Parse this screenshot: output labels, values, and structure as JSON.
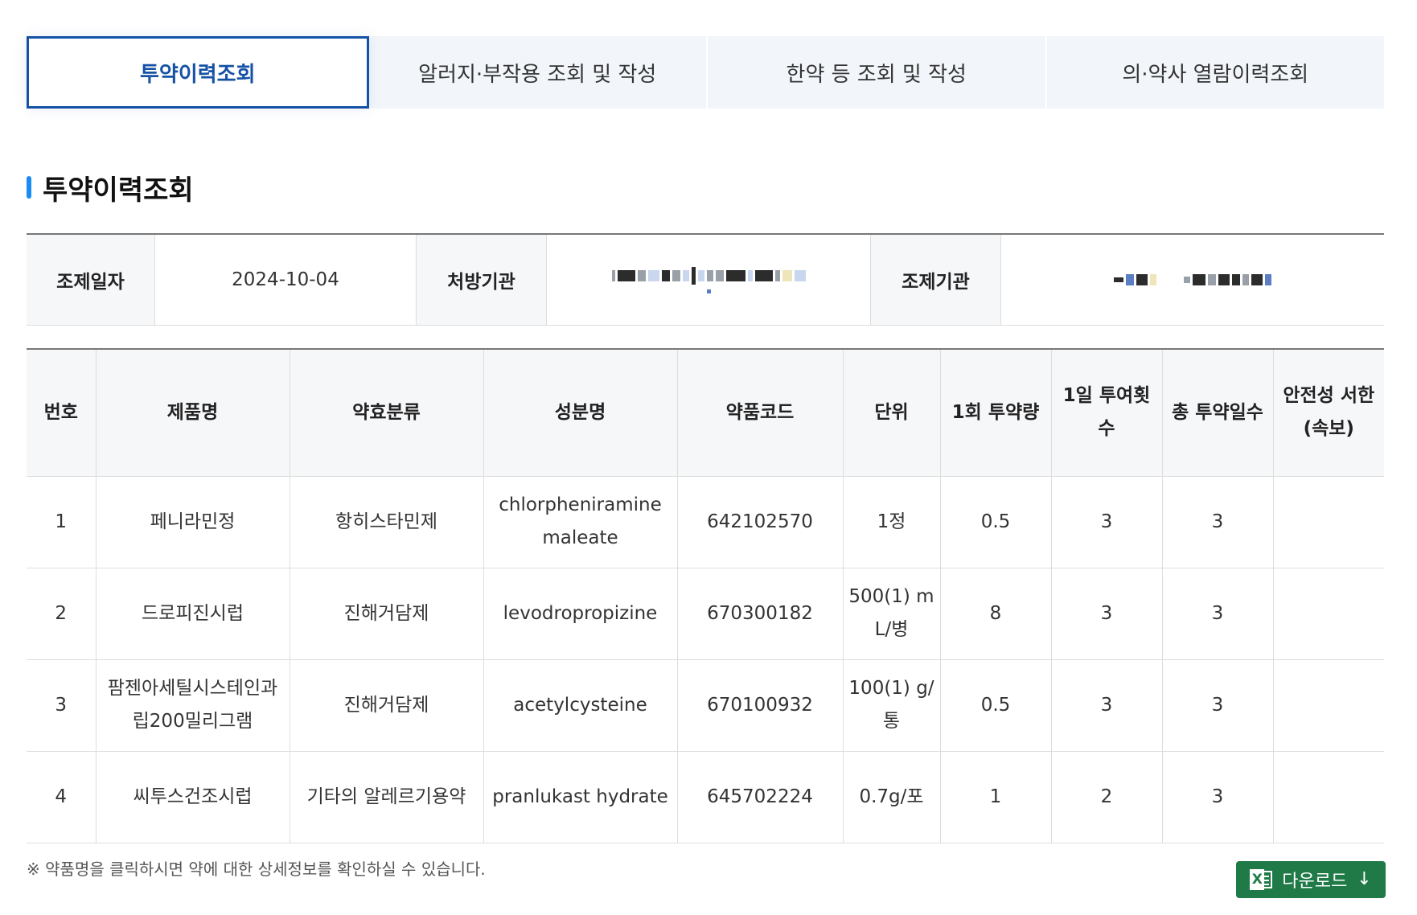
{
  "tabs": [
    {
      "label": "투약이력조회",
      "active": true
    },
    {
      "label": "알러지·부작용 조회 및 작성",
      "active": false
    },
    {
      "label": "한약 등 조회 및 작성",
      "active": false
    },
    {
      "label": "의·약사 열람이력조회",
      "active": false
    }
  ],
  "section_title": "투약이력조회",
  "info": {
    "dispense_date_label": "조제일자",
    "dispense_date": "2024-10-04",
    "prescriber_label": "처방기관",
    "prescriber_value_redacted": true,
    "pharmacy_label": "조제기관",
    "pharmacy_value_redacted": true
  },
  "table": {
    "headers": {
      "no": "번호",
      "product": "제품명",
      "class": "약효분류",
      "ingredient": "성분명",
      "code": "약품코드",
      "unit": "단위",
      "dose": "1회 투약량",
      "daily": "1일 투여횟수",
      "days": "총 투약일수",
      "safety": "안전성 서한(속보)"
    },
    "rows": [
      {
        "no": "1",
        "product": "페니라민정",
        "class": "항히스타민제",
        "ingredient": "chlorpheniramine maleate",
        "code": "642102570",
        "unit": "1정",
        "dose": "0.5",
        "daily": "3",
        "days": "3",
        "safety": ""
      },
      {
        "no": "2",
        "product": "드로피진시럽",
        "class": "진해거담제",
        "ingredient": "levodropropizine",
        "code": "670300182",
        "unit": "500(1) mL/병",
        "dose": "8",
        "daily": "3",
        "days": "3",
        "safety": ""
      },
      {
        "no": "3",
        "product": "팜젠아세틸시스테인과립200밀리그램",
        "class": "진해거담제",
        "ingredient": "acetylcysteine",
        "code": "670100932",
        "unit": "100(1) g/통",
        "dose": "0.5",
        "daily": "3",
        "days": "3",
        "safety": ""
      },
      {
        "no": "4",
        "product": "씨투스건조시럽",
        "class": "기타의 알레르기용약",
        "ingredient": "pranlukast hydrate",
        "code": "645702224",
        "unit": "0.7g/포",
        "dose": "1",
        "daily": "2",
        "days": "3",
        "safety": ""
      }
    ]
  },
  "note": "※ 약품명을 클릭하시면 약에 대한 상세정보를 확인하실 수 있습니다.",
  "download": {
    "label": "다운로드",
    "icon": "excel-icon",
    "arrow_icon": "arrow-down-icon"
  },
  "colors": {
    "accent": "#1552a5",
    "title_bar": "#1a8af5",
    "download_bg": "#1f7a48"
  }
}
